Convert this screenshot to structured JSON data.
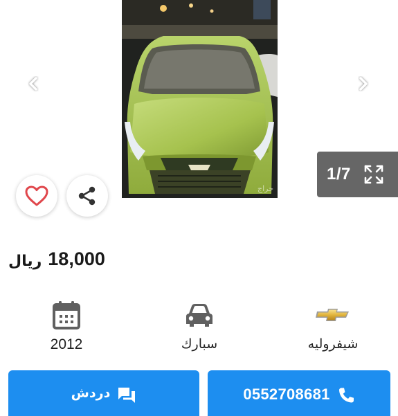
{
  "gallery": {
    "counter": "1/7",
    "image_alt_icon": "car-photo",
    "prev_icon": "chevron-left-icon",
    "next_icon": "chevron-right-icon",
    "expand_icon": "expand-icon",
    "watermark": "حراج"
  },
  "actions": {
    "favorite_icon": "heart-icon",
    "share_icon": "share-icon"
  },
  "listing": {
    "price": "18,000",
    "currency": "ريال"
  },
  "specs": [
    {
      "icon": "calendar-icon",
      "label": "2012"
    },
    {
      "icon": "car-icon",
      "label": "سبارك"
    },
    {
      "icon": "chevrolet-logo",
      "label": "شيفروليه"
    }
  ],
  "buttons": {
    "chat_label": "دردش",
    "chat_icon": "chat-icon",
    "call_label": "0552708681",
    "call_icon": "phone-icon"
  },
  "colors": {
    "primary": "#1d8ef0",
    "favorite": "#e0474c",
    "counter_bg": "#666666"
  }
}
